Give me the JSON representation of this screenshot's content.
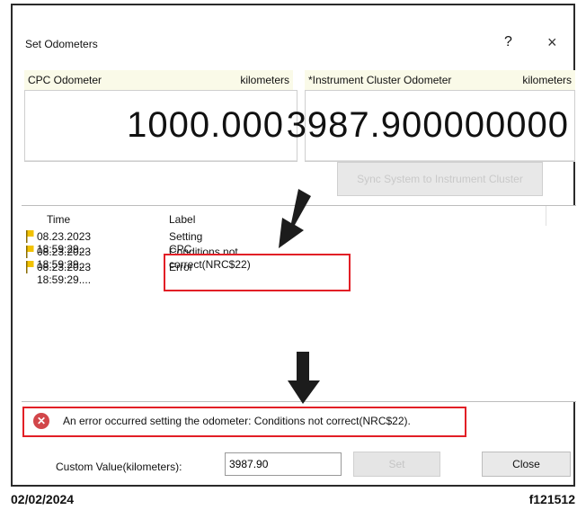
{
  "dialog": {
    "title": "Set Odometers",
    "help_label": "?",
    "close_glyph": "×"
  },
  "cpc": {
    "label": "CPC Odometer",
    "unit": "kilometers",
    "value": "1000.000"
  },
  "cluster": {
    "label": "*Instrument Cluster Odometer",
    "unit": "kilometers",
    "value": "3987.900000000"
  },
  "sync_button": {
    "label": "Sync System to Instrument Cluster"
  },
  "log": {
    "columns": [
      "Time",
      "Label"
    ],
    "rows": [
      {
        "time": "08.23.2023 18:59:29....",
        "label": "Setting CPC"
      },
      {
        "time": "08.23.2023 18:59:29....",
        "label": "Conditions not correct(NRC$22)"
      },
      {
        "time": "08.23.2023 18:59:29....",
        "label": "Error"
      }
    ]
  },
  "error": {
    "icon": "error-x-icon",
    "message": "An error occurred setting the odometer: Conditions not correct(NRC$22)."
  },
  "custom": {
    "label": "Custom Value(kilometers):",
    "value": "3987.90"
  },
  "set_button": {
    "label": "Set"
  },
  "close_button": {
    "label": "Close"
  },
  "footer": {
    "date": "02/02/2024",
    "figure_id": "f121512"
  },
  "colors": {
    "highlight": "#e21f26",
    "header_bg": "#fafae8",
    "error_icon": "#d2464a"
  }
}
